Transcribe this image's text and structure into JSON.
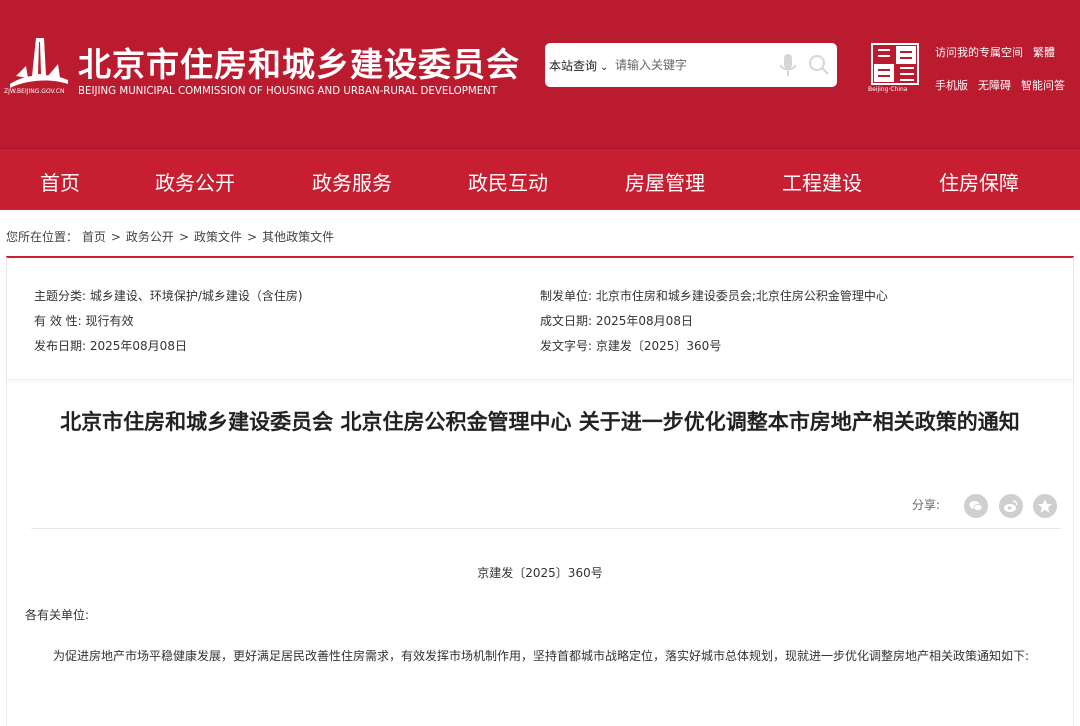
{
  "header": {
    "title": "北京市住房和城乡建设委员会",
    "subtitle": "BEIJING MUNICIPAL COMMISSION OF HOUSING AND URBAN-RURAL DEVELOPMENT",
    "domain": "ZJW.BEIJING.GOV.CN",
    "brand_color": "#bb1b2f"
  },
  "search": {
    "scope_label": "本站查询",
    "placeholder": "请输入关键字"
  },
  "capital_logo": {
    "caption": "Beijing·China"
  },
  "top_links": {
    "my_space": "访问我的专属空间",
    "traditional": "繁體",
    "mobile": "手机版",
    "accessible": "无障碍",
    "smart_qa": "智能问答"
  },
  "nav": {
    "items": [
      "首页",
      "政务公开",
      "政务服务",
      "政民互动",
      "房屋管理",
      "工程建设",
      "住房保障"
    ]
  },
  "breadcrumb": {
    "prefix": "您所在位置：",
    "items": [
      "首页",
      "政务公开",
      "政策文件",
      "其他政策文件"
    ],
    "separator": ">"
  },
  "meta": {
    "topic_label": "主题分类:",
    "topic_value": "城乡建设、环境保护/城乡建设（含住房)",
    "validity_label": "有 效 性:",
    "validity_value": "现行有效",
    "publish_label": "发布日期:",
    "publish_value": "2025年08月08日",
    "issuer_label": "制发单位:",
    "issuer_value": "北京市住房和城乡建设委员会;北京住房公积金管理中心",
    "created_label": "成文日期:",
    "created_value": "2025年08月08日",
    "docno_label": "发文字号:",
    "docno_value": "京建发〔2025〕360号"
  },
  "article": {
    "title": "北京市住房和城乡建设委员会 北京住房公积金管理中心 关于进一步优化调整本市房地产相关政策的通知",
    "share_label": "分享:",
    "doc_number": "京建发〔2025〕360号",
    "salutation": "各有关单位:",
    "paragraph1": "为促进房地产市场平稳健康发展，更好满足居民改善性住房需求，有效发挥市场机制作用，坚持首都城市战略定位，落实好城市总体规划，现就进一步优化调整房地产相关政策通知如下:"
  }
}
